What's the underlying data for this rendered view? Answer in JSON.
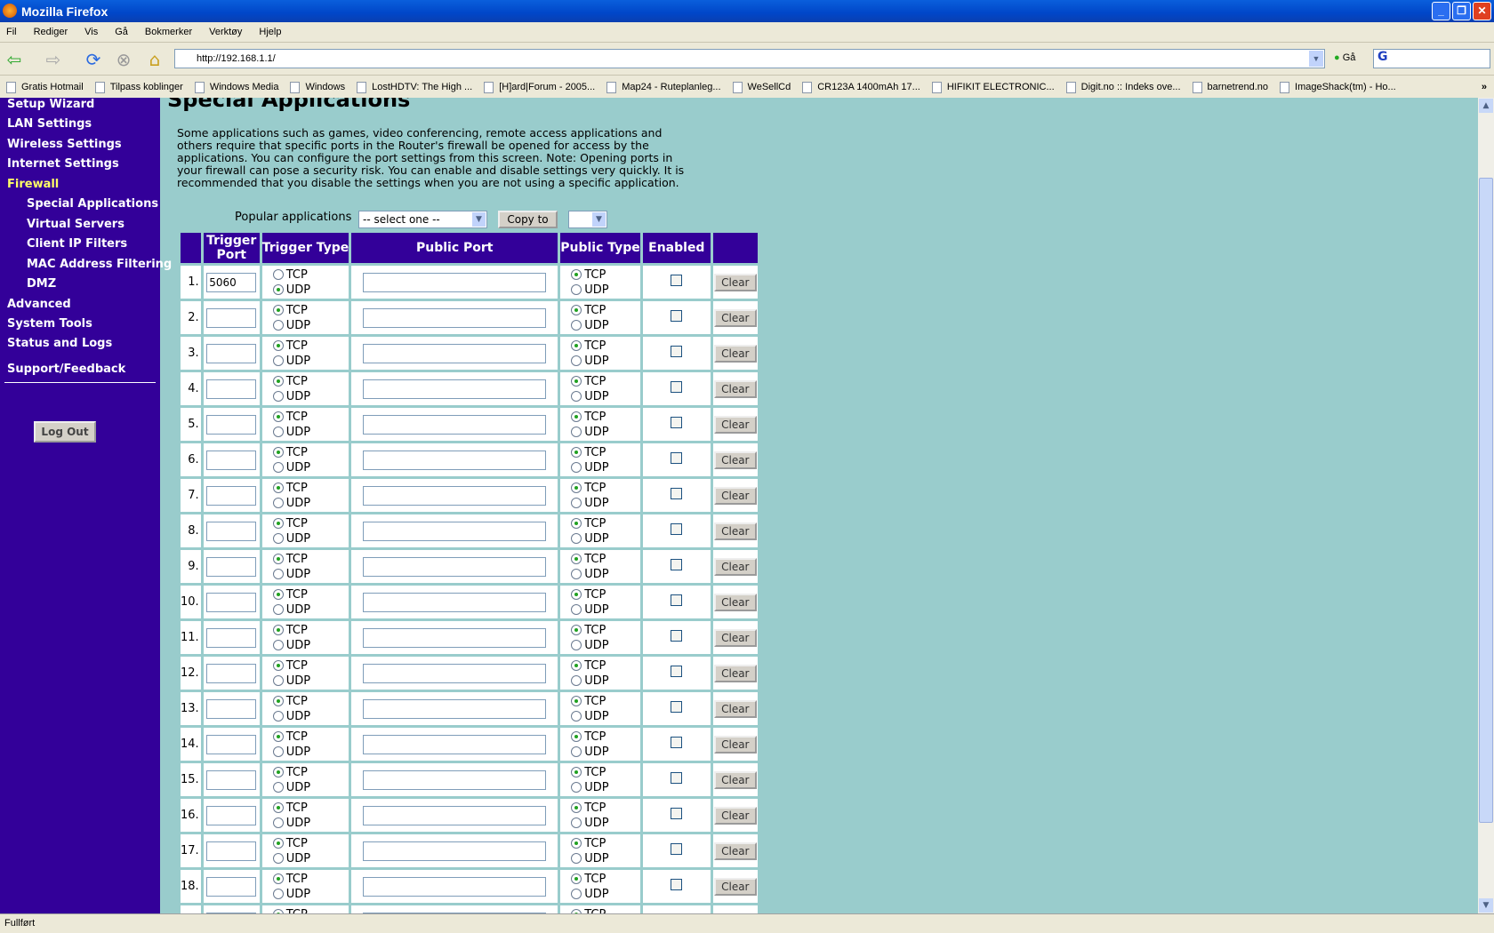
{
  "window": {
    "title": "Mozilla Firefox"
  },
  "menu": [
    "Fil",
    "Rediger",
    "Vis",
    "Gå",
    "Bokmerker",
    "Verktøy",
    "Hjelp"
  ],
  "toolbar": {
    "url": "http://192.168.1.1/",
    "go_label": "Gå"
  },
  "bookmarks": [
    "Gratis Hotmail",
    "Tilpass koblinger",
    "Windows Media",
    "Windows",
    "LostHDTV: The High ...",
    "[H]ard|Forum - 2005...",
    "Map24 - Ruteplanleg...",
    "WeSellCd",
    "CR123A 1400mAh 17...",
    "HIFIKIT ELECTRONIC...",
    "Digit.no :: Indeks ove...",
    "barnetrend.no",
    "ImageShack(tm) - Ho..."
  ],
  "sidebar": {
    "items": [
      {
        "label": "Setup Wizard"
      },
      {
        "label": "LAN Settings"
      },
      {
        "label": "Wireless Settings"
      },
      {
        "label": "Internet Settings"
      },
      {
        "label": "Firewall"
      },
      {
        "label": "Special Applications"
      },
      {
        "label": "Virtual Servers"
      },
      {
        "label": "Client IP Filters"
      },
      {
        "label": "MAC Address Filtering"
      },
      {
        "label": "DMZ"
      },
      {
        "label": "Advanced"
      },
      {
        "label": "System Tools"
      },
      {
        "label": "Status and Logs"
      }
    ],
    "support": "Support/Feedback",
    "logout": "Log Out"
  },
  "page": {
    "title": "Special Applications",
    "intro": "Some applications such as games, video conferencing, remote access applications and others require that specific ports in the Router's firewall be opened for access by the applications. You can configure the port settings from this screen. Note: Opening ports in your firewall can pose a security risk. You can enable and disable settings very quickly. It is recommended that you disable the settings when you are not using a specific application.",
    "popular_label": "Popular applications",
    "popular_value": "-- select one --",
    "copy_to": "Copy to",
    "headers": {
      "trigger_port": "Trigger Port",
      "trigger_type": "Trigger Type",
      "public_port": "Public Port",
      "public_type": "Public Type",
      "enabled": "Enabled"
    },
    "tcp": "TCP",
    "udp": "UDP",
    "clear": "Clear",
    "rows": [
      {
        "n": "1.",
        "trigger_port": "5060",
        "trigger_type": "UDP",
        "public_port": "",
        "public_type": "TCP",
        "enabled": false
      },
      {
        "n": "2.",
        "trigger_port": "",
        "trigger_type": "TCP",
        "public_port": "",
        "public_type": "TCP",
        "enabled": false
      },
      {
        "n": "3.",
        "trigger_port": "",
        "trigger_type": "TCP",
        "public_port": "",
        "public_type": "TCP",
        "enabled": false
      },
      {
        "n": "4.",
        "trigger_port": "",
        "trigger_type": "TCP",
        "public_port": "",
        "public_type": "TCP",
        "enabled": false
      },
      {
        "n": "5.",
        "trigger_port": "",
        "trigger_type": "TCP",
        "public_port": "",
        "public_type": "TCP",
        "enabled": false
      },
      {
        "n": "6.",
        "trigger_port": "",
        "trigger_type": "TCP",
        "public_port": "",
        "public_type": "TCP",
        "enabled": false
      },
      {
        "n": "7.",
        "trigger_port": "",
        "trigger_type": "TCP",
        "public_port": "",
        "public_type": "TCP",
        "enabled": false
      },
      {
        "n": "8.",
        "trigger_port": "",
        "trigger_type": "TCP",
        "public_port": "",
        "public_type": "TCP",
        "enabled": false
      },
      {
        "n": "9.",
        "trigger_port": "",
        "trigger_type": "TCP",
        "public_port": "",
        "public_type": "TCP",
        "enabled": false
      },
      {
        "n": "10.",
        "trigger_port": "",
        "trigger_type": "TCP",
        "public_port": "",
        "public_type": "TCP",
        "enabled": false
      },
      {
        "n": "11.",
        "trigger_port": "",
        "trigger_type": "TCP",
        "public_port": "",
        "public_type": "TCP",
        "enabled": false
      },
      {
        "n": "12.",
        "trigger_port": "",
        "trigger_type": "TCP",
        "public_port": "",
        "public_type": "TCP",
        "enabled": false
      },
      {
        "n": "13.",
        "trigger_port": "",
        "trigger_type": "TCP",
        "public_port": "",
        "public_type": "TCP",
        "enabled": false
      },
      {
        "n": "14.",
        "trigger_port": "",
        "trigger_type": "TCP",
        "public_port": "",
        "public_type": "TCP",
        "enabled": false
      },
      {
        "n": "15.",
        "trigger_port": "",
        "trigger_type": "TCP",
        "public_port": "",
        "public_type": "TCP",
        "enabled": false
      },
      {
        "n": "16.",
        "trigger_port": "",
        "trigger_type": "TCP",
        "public_port": "",
        "public_type": "TCP",
        "enabled": false
      },
      {
        "n": "17.",
        "trigger_port": "",
        "trigger_type": "TCP",
        "public_port": "",
        "public_type": "TCP",
        "enabled": false
      },
      {
        "n": "18.",
        "trigger_port": "",
        "trigger_type": "TCP",
        "public_port": "",
        "public_type": "TCP",
        "enabled": false
      },
      {
        "n": "",
        "trigger_port": "",
        "trigger_type": "TCP",
        "public_port": "",
        "public_type": "TCP",
        "enabled": false
      }
    ]
  },
  "status": {
    "text": "Fullført"
  },
  "colors": {
    "sidebar": "#330099",
    "content": "#99cccc",
    "active": "#ffff66"
  }
}
